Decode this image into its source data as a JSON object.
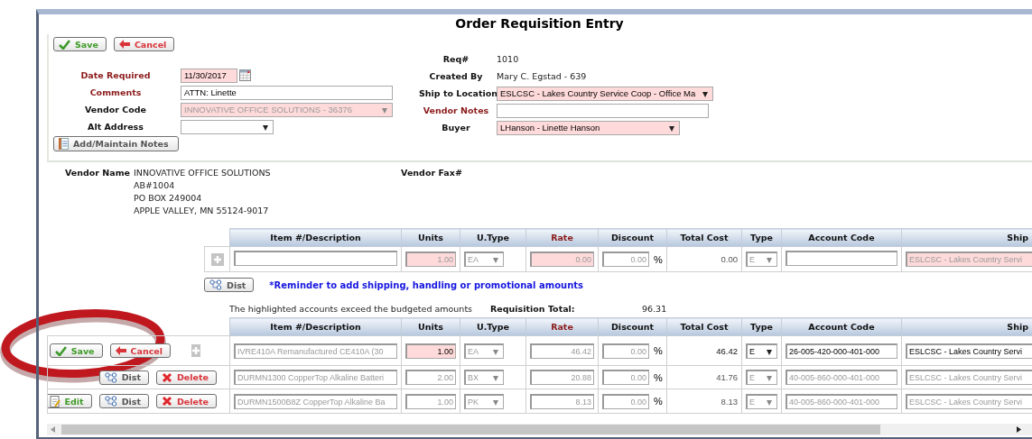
{
  "window": {
    "title": "Order Requisition Entry"
  },
  "toolbar": [
    {
      "kind": "save",
      "label": "Save"
    },
    {
      "kind": "cancel",
      "label": "Cancel"
    }
  ],
  "form_left": [
    {
      "label": "Date Required",
      "required": true,
      "kind": "date",
      "value": "11/30/2017",
      "highlighted": true,
      "disabled": false
    },
    {
      "label": "Comments",
      "required": true,
      "kind": "text",
      "value": "ATTN: Linette",
      "highlighted": false,
      "disabled": false
    },
    {
      "label": "Vendor Code",
      "required": false,
      "kind": "select",
      "value": "INNOVATIVE OFFICE SOLUTIONS - 36376",
      "highlighted": true,
      "disabled": true
    },
    {
      "label": "Alt Address",
      "required": false,
      "kind": "select",
      "highlighted": false,
      "disabled": false
    }
  ],
  "notes_button": {
    "label": "Add/Maintain Notes"
  },
  "form_right": [
    {
      "label": "Req#",
      "required": false,
      "kind": "static",
      "value": "1010"
    },
    {
      "label": "Created By",
      "required": false,
      "kind": "static",
      "value": "Mary C. Egstad - 639"
    },
    {
      "label": "Ship to Location",
      "required": false,
      "kind": "select",
      "value": "ESLCSC - Lakes Country Service Coop - Office Ma",
      "highlighted": true,
      "disabled": false
    },
    {
      "label": "Vendor Notes",
      "required": true,
      "kind": "text",
      "highlighted": false,
      "disabled": false
    },
    {
      "label": "Buyer",
      "required": false,
      "kind": "select",
      "value": "LHanson - Linette Hanson",
      "highlighted": true,
      "disabled": false
    }
  ],
  "vendor": {
    "name_label": "Vendor Name",
    "address_lines": [
      "INNOVATIVE OFFICE SOLUTIONS",
      "AB#1004",
      "PO BOX 249004",
      "APPLE VALLEY, MN 55124-9017"
    ],
    "fax_label": "Vendor Fax#"
  },
  "new_item_table": {
    "columns": [
      {
        "label": "Item #/Description",
        "required": false
      },
      {
        "label": "Units",
        "required": false
      },
      {
        "label": "U.Type",
        "required": false
      },
      {
        "label": "Rate",
        "required": true
      },
      {
        "label": "Discount",
        "required": false
      },
      {
        "label": "Total Cost",
        "required": false
      },
      {
        "label": "Type",
        "required": false
      },
      {
        "label": "Account Code",
        "required": false
      },
      {
        "label": "Ship",
        "required": false
      }
    ],
    "row": {
      "units": "1.00",
      "units_highlighted": true,
      "utype": "EA",
      "rate": "0.00",
      "rate_highlighted": true,
      "discount": "0.00",
      "percent": "%",
      "total": "0.00",
      "type": "E",
      "ship": "ESLCSC - Lakes Country Servi",
      "ship_highlighted": true,
      "locked": true
    }
  },
  "dist_button": {
    "label": "Dist"
  },
  "reminder": "*Reminder to add shipping, handling or promotional amounts",
  "budget_note": "The highlighted accounts exceed the budgeted amounts",
  "total_label": "Requisition Total:",
  "total_value": "96.31",
  "lines_table": {
    "columns": [
      {
        "label": "Item #/Description",
        "required": false
      },
      {
        "label": "Units",
        "required": false
      },
      {
        "label": "U.Type",
        "required": false
      },
      {
        "label": "Rate",
        "required": true
      },
      {
        "label": "Discount",
        "required": false
      },
      {
        "label": "Total Cost",
        "required": false
      },
      {
        "label": "Type",
        "required": false
      },
      {
        "label": "Account Code",
        "required": false
      },
      {
        "label": "Ship",
        "required": false
      }
    ],
    "rows": [
      {
        "actions": [
          {
            "kind": "save",
            "label": "Save"
          },
          {
            "kind": "cancel",
            "label": "Cancel"
          },
          {
            "kind": "add"
          }
        ],
        "description": "IVRE410A Remanufactured CE410A (30",
        "units": "1.00",
        "units_highlighted": true,
        "utype": "EA",
        "rate": "46.42",
        "rate_highlighted": false,
        "discount": "0.00",
        "percent": "%",
        "total": "46.42",
        "type": "E",
        "account": "26-005-420-000-401-000",
        "ship": "ESLCSC - Lakes Country Servi",
        "ship_highlighted": false,
        "locked": false
      },
      {
        "actions": [
          {
            "kind": "dist",
            "label": "Dist"
          },
          {
            "kind": "delete",
            "label": "Delete"
          }
        ],
        "description": "DURMN1300 CopperTop Alkaline Batteri",
        "units": "2.00",
        "units_highlighted": false,
        "utype": "BX",
        "rate": "20.88",
        "rate_highlighted": false,
        "discount": "0.00",
        "percent": "%",
        "total": "41.76",
        "type": "E",
        "account": "40-005-860-000-401-000",
        "ship": "ESLCSC - Lakes Country Servi",
        "ship_highlighted": false,
        "locked": true
      },
      {
        "actions": [
          {
            "kind": "edit",
            "label": "Edit"
          },
          {
            "kind": "dist",
            "label": "Dist"
          },
          {
            "kind": "delete",
            "label": "Delete"
          }
        ],
        "description": "DURMN1500B8Z CopperTop Alkaline Ba",
        "units": "1.00",
        "units_highlighted": false,
        "utype": "PK",
        "rate": "8.13",
        "rate_highlighted": false,
        "discount": "0.00",
        "percent": "%",
        "total": "8.13",
        "type": "E",
        "account": "40-005-860-000-401-000",
        "ship": "ESLCSC - Lakes Country Servi",
        "ship_highlighted": false,
        "locked": true
      }
    ]
  }
}
